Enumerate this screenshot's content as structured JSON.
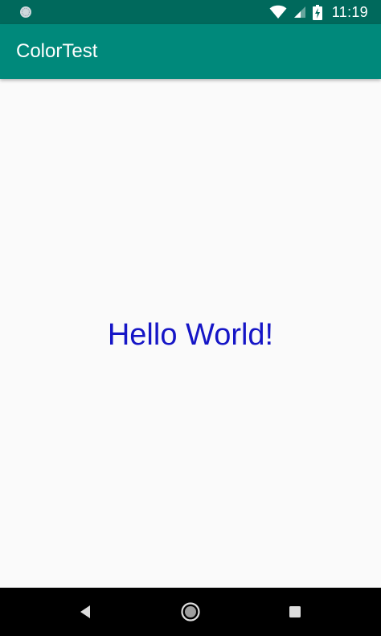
{
  "status_bar": {
    "time": "11:19",
    "icons": [
      "notification-dot-icon",
      "wifi-icon",
      "cell-signal-icon",
      "battery-charging-icon"
    ],
    "background": "#00695c"
  },
  "app_bar": {
    "title": "ColorTest",
    "background": "#00897b"
  },
  "main": {
    "text": "Hello World!",
    "text_color": "#1515c6",
    "background": "#fafafa"
  },
  "nav_bar": {
    "buttons": [
      "back-icon",
      "home-icon",
      "recents-icon"
    ],
    "background": "#000000"
  }
}
